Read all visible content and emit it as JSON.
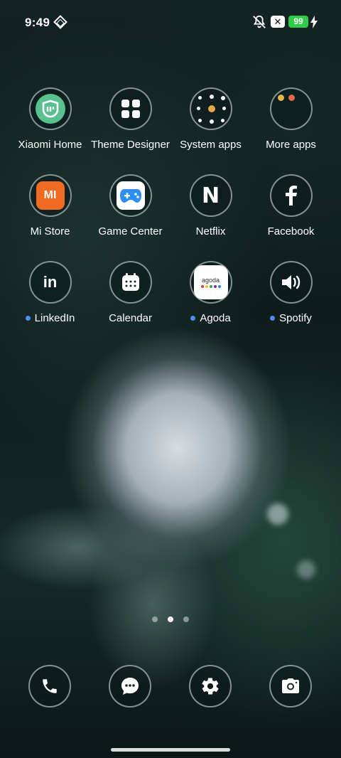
{
  "status_bar": {
    "time": "9:49",
    "battery_level": "99",
    "x_badge": "✕",
    "icons": [
      "diamond-icon",
      "mute-icon",
      "x-box-icon",
      "battery-icon",
      "charging-bolt-icon"
    ],
    "battery_color": "#2fcc4b"
  },
  "apps": [
    {
      "label": "Xiaomi Home",
      "icon": "mi-home-icon"
    },
    {
      "label": "Theme Designer",
      "icon": "theme-grid-icon"
    },
    {
      "label": "System apps",
      "icon": "system-apps-folder-icon"
    },
    {
      "label": "More apps",
      "icon": "more-apps-folder-icon"
    },
    {
      "label": "Mi Store",
      "icon": "mi-store-icon",
      "icon_text": "MI"
    },
    {
      "label": "Game Center",
      "icon": "gamepad-icon"
    },
    {
      "label": "Netflix",
      "icon": "netflix-icon",
      "icon_text": "N"
    },
    {
      "label": "Facebook",
      "icon": "facebook-icon"
    },
    {
      "label": "LinkedIn",
      "icon": "linkedin-icon",
      "icon_text": "in",
      "new_dot": true
    },
    {
      "label": "Calendar",
      "icon": "calendar-icon"
    },
    {
      "label": "Agoda",
      "icon": "agoda-icon",
      "icon_text": "agoda",
      "new_dot": true
    },
    {
      "label": "Spotify",
      "icon": "speaker-icon",
      "new_dot": true
    }
  ],
  "page_indicator": {
    "pages": 3,
    "current": 2
  },
  "dock": [
    {
      "icon": "phone-icon"
    },
    {
      "icon": "messages-icon"
    },
    {
      "icon": "settings-gear-icon"
    },
    {
      "icon": "camera-icon"
    }
  ],
  "colors": {
    "new_dot": "#4d8ef7",
    "mi_home": "#59c090",
    "mi_store": "#f06a22",
    "game_center": "#2a8ef2"
  }
}
